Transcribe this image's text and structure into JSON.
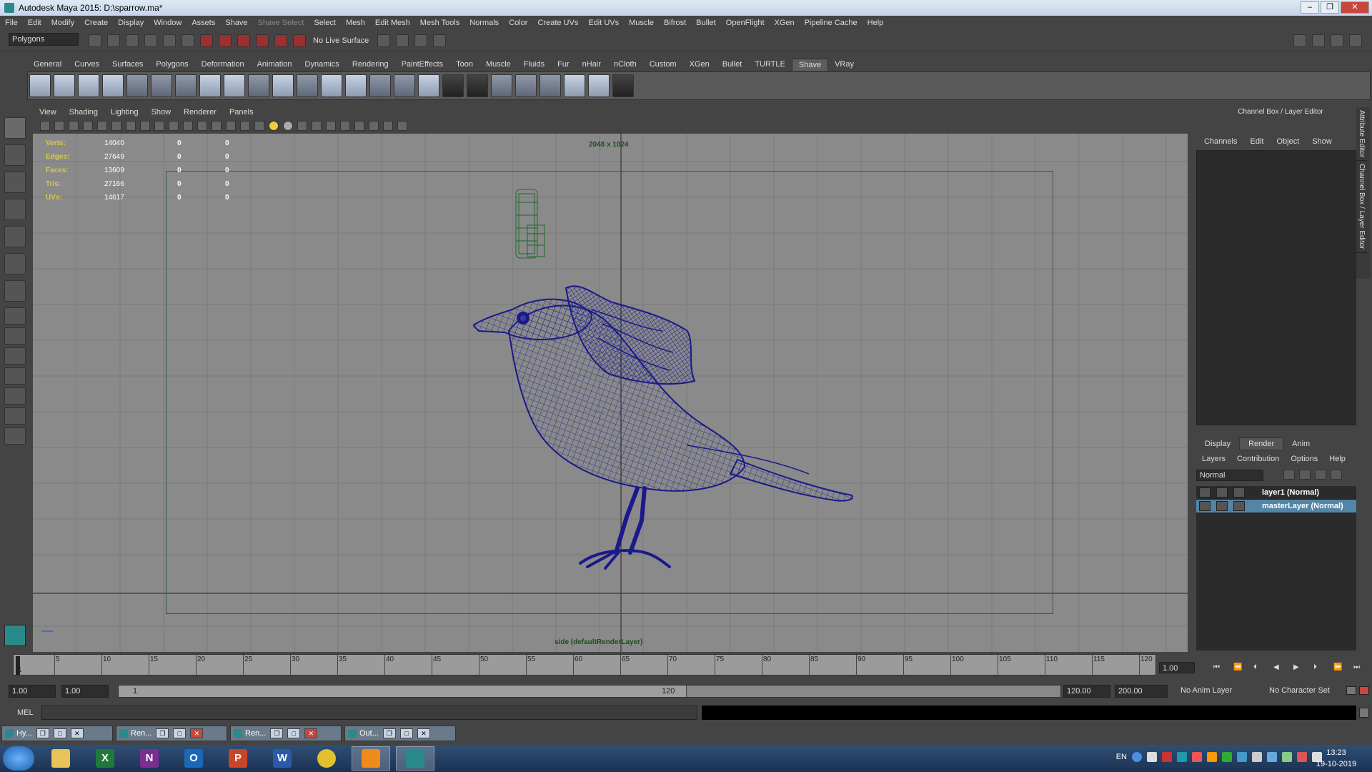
{
  "window": {
    "title": "Autodesk Maya 2015: D:\\sparrow.ma*",
    "controls": {
      "minimize": "–",
      "restore": "❐",
      "close": "✕"
    }
  },
  "menubar": [
    "File",
    "Edit",
    "Modify",
    "Create",
    "Display",
    "Window",
    "Assets",
    "Shave",
    "Shave Select",
    "Select",
    "Mesh",
    "Edit Mesh",
    "Mesh Tools",
    "Normals",
    "Color",
    "Create UVs",
    "Edit UVs",
    "Muscle",
    "Bifrost",
    "Bullet",
    "OpenFlight",
    "XGen",
    "Pipeline Cache",
    "Help"
  ],
  "statusline": {
    "mode": "Polygons",
    "live_surface": "No Live Surface"
  },
  "shelf": {
    "tabs": [
      "General",
      "Curves",
      "Surfaces",
      "Polygons",
      "Deformation",
      "Animation",
      "Dynamics",
      "Rendering",
      "PaintEffects",
      "Toon",
      "Muscle",
      "Fluids",
      "Fur",
      "nHair",
      "nCloth",
      "Custom",
      "XGen",
      "Bullet",
      "TURTLE",
      "Shave",
      "VRay"
    ],
    "active_tab": "Shave"
  },
  "viewport": {
    "menu": [
      "View",
      "Shading",
      "Lighting",
      "Show",
      "Renderer",
      "Panels"
    ],
    "hud": {
      "rows": [
        {
          "label": "Verts:",
          "value": "14040",
          "a": "0",
          "b": "0"
        },
        {
          "label": "Edges:",
          "value": "27649",
          "a": "0",
          "b": "0"
        },
        {
          "label": "Faces:",
          "value": "13609",
          "a": "0",
          "b": "0"
        },
        {
          "label": "Tris:",
          "value": "27166",
          "a": "0",
          "b": "0"
        },
        {
          "label": "UVs:",
          "value": "14617",
          "a": "0",
          "b": "0"
        }
      ]
    },
    "resolution_label": "2048 x 1024",
    "camera_label": "side (defaultRenderLayer)",
    "wireframe_color": "#1a1a8c",
    "background_color": "#8a8a8a"
  },
  "channel_box": {
    "title": "Channel Box / Layer Editor",
    "menu": [
      "Channels",
      "Edit",
      "Object",
      "Show"
    ]
  },
  "layer_editor": {
    "tabs": [
      "Display",
      "Render",
      "Anim"
    ],
    "active_tab": "Render",
    "menu": [
      "Layers",
      "Contribution",
      "Options",
      "Help"
    ],
    "blend_mode": "Normal",
    "layers": [
      {
        "name": "layer1 (Normal)",
        "selected": false
      },
      {
        "name": "masterLayer (Normal)",
        "selected": true
      }
    ]
  },
  "side_tabs": [
    "Attribute Editor",
    "Channel Box / Layer Editor"
  ],
  "timeline": {
    "ticks": [
      "1",
      "5",
      "10",
      "15",
      "20",
      "25",
      "30",
      "35",
      "40",
      "45",
      "50",
      "55",
      "60",
      "65",
      "70",
      "75",
      "80",
      "85",
      "90",
      "95",
      "100",
      "105",
      "110",
      "115",
      "120"
    ],
    "current_frame": "1.00"
  },
  "range": {
    "start": "1.00",
    "current": "1.00",
    "range_start_label": "1",
    "range_end_label": "120",
    "end": "120.00",
    "max": "200.00",
    "anim_layer": "No Anim Layer",
    "character_set": "No Character Set"
  },
  "command_line": {
    "label": "MEL"
  },
  "minimized_windows": [
    "Hy...",
    "Ren...",
    "Ren...",
    "Out..."
  ],
  "taskbar": {
    "apps": [
      "explorer",
      "excel",
      "onenote",
      "outlook",
      "powerpoint",
      "word",
      "chrome",
      "vlc",
      "maya"
    ],
    "language": "EN",
    "time": "13:23",
    "date": "19-10-2019"
  }
}
